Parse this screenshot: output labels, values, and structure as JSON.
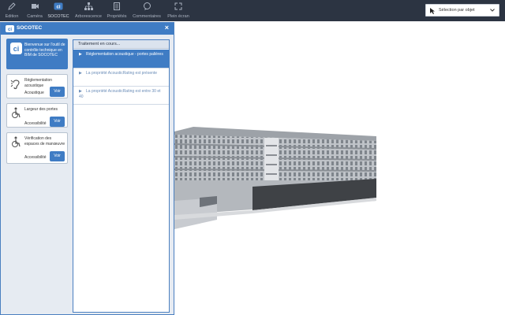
{
  "toolbar": {
    "items": [
      {
        "label": "Edition",
        "icon": "pencil-icon"
      },
      {
        "label": "Caméra",
        "icon": "camera-icon"
      },
      {
        "label": "SOCOTEC",
        "icon": "socotec-icon"
      },
      {
        "label": "Arborescence",
        "icon": "tree-icon"
      },
      {
        "label": "Propriétés",
        "icon": "properties-icon"
      },
      {
        "label": "Commentaires",
        "icon": "comments-icon"
      },
      {
        "label": "Plein écran",
        "icon": "fullscreen-icon"
      }
    ],
    "selection_mode": "Sélection par objet"
  },
  "panel": {
    "title": "SOCOTEC",
    "welcome": "Bienvenue sur l'outil de contrôle technique en BIM de SOCOTEC",
    "cards": [
      {
        "title": "Réglementation acoustique",
        "tag": "Acoustique",
        "button": "Voir"
      },
      {
        "title": "Largeur des portes",
        "tag": "Accessibilité",
        "button": "Voir"
      },
      {
        "title": "Vérification des espaces de manœuvre",
        "tag": "Accessibilité",
        "button": "Voir"
      }
    ],
    "processing": {
      "header": "Traitement en cours...",
      "items": [
        "Réglementation acoustique - portes palières",
        "La propriété AcousticRating est présente",
        "La propriété AcousticRating est entre 30 et 40"
      ]
    }
  },
  "colors": {
    "toolbar_bg": "#2c3442",
    "accent": "#3f7cc4",
    "panel_bg": "#e6ebf2"
  }
}
